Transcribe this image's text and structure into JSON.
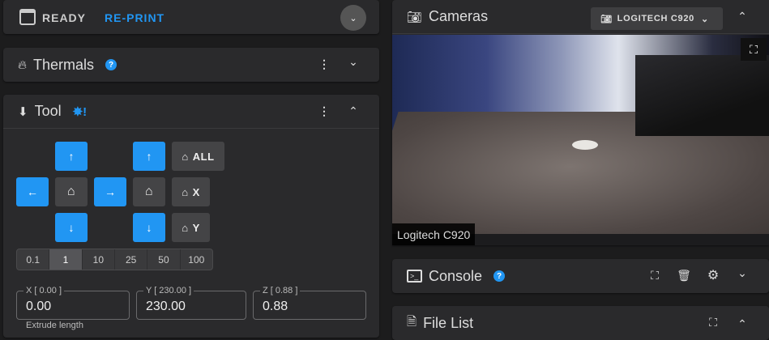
{
  "status": {
    "state": "READY",
    "reprint": "RE-PRINT"
  },
  "thermals": {
    "title": "Thermals",
    "help": "?"
  },
  "tool": {
    "title": "Tool",
    "home_all": "ALL",
    "home_x": "X",
    "home_y": "Y",
    "steps": [
      "0.1",
      "1",
      "10",
      "25",
      "50",
      "100"
    ],
    "selected_step": "1",
    "fields": [
      {
        "label": "X [ 0.00 ]",
        "value": "0.00"
      },
      {
        "label": "Y [ 230.00 ]",
        "value": "230.00"
      },
      {
        "label": "Z [ 0.88 ]",
        "value": "0.88"
      }
    ],
    "extrude_label": "Extrude length"
  },
  "cameras": {
    "title": "Cameras",
    "selected": "LOGITECH C920",
    "overlay": "Logitech C920"
  },
  "console": {
    "title": "Console",
    "help": "?"
  },
  "file_list": {
    "title": "File List"
  },
  "colors": {
    "accent": "#2196f3",
    "card": "#2a2a2c",
    "background": "#1c1c1d"
  }
}
